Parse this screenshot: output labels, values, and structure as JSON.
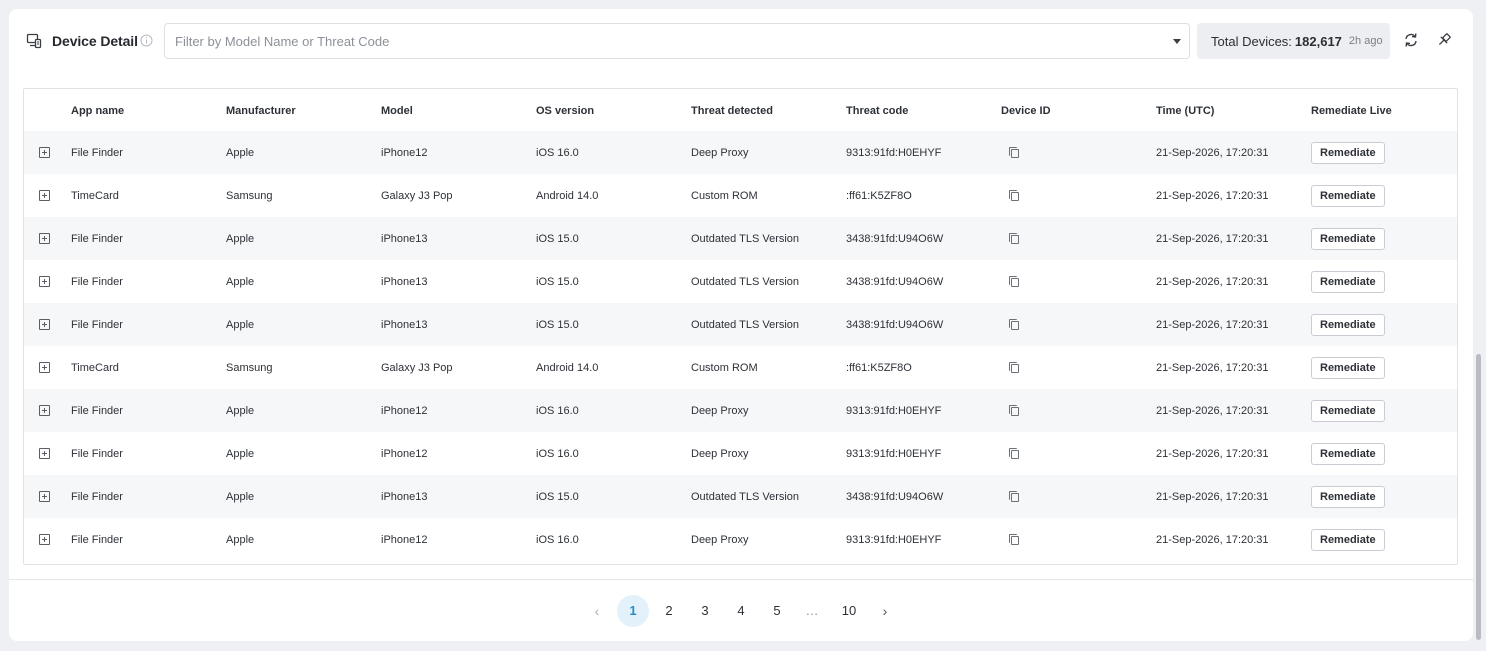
{
  "header": {
    "title": "Device Detail",
    "filter_placeholder": "Filter by Model Name or Threat Code",
    "total_label": "Total Devices:",
    "total_count": "182,617",
    "updated": "2h ago"
  },
  "table": {
    "columns": [
      "App name",
      "Manufacturer",
      "Model",
      "OS version",
      "Threat detected",
      "Threat code",
      "Device ID",
      "Time (UTC)",
      "Remediate Live"
    ],
    "remediate_label": "Remediate",
    "rows": [
      {
        "app": "File Finder",
        "manufacturer": "Apple",
        "model": "iPhone12",
        "os": "iOS 16.0",
        "threat": "Deep Proxy",
        "code": "9313:91fd:H0EHYF",
        "time": "21-Sep-2026, 17:20:31"
      },
      {
        "app": "TimeCard",
        "manufacturer": "Samsung",
        "model": "Galaxy J3 Pop",
        "os": "Android 14.0",
        "threat": "Custom ROM",
        "code": ":ff61:K5ZF8O",
        "time": "21-Sep-2026, 17:20:31"
      },
      {
        "app": "File Finder",
        "manufacturer": "Apple",
        "model": "iPhone13",
        "os": "iOS 15.0",
        "threat": "Outdated TLS Version",
        "code": "3438:91fd:U94O6W",
        "time": "21-Sep-2026, 17:20:31"
      },
      {
        "app": "File Finder",
        "manufacturer": "Apple",
        "model": "iPhone13",
        "os": "iOS 15.0",
        "threat": "Outdated TLS Version",
        "code": "3438:91fd:U94O6W",
        "time": "21-Sep-2026, 17:20:31"
      },
      {
        "app": "File Finder",
        "manufacturer": "Apple",
        "model": "iPhone13",
        "os": "iOS 15.0",
        "threat": "Outdated TLS Version",
        "code": "3438:91fd:U94O6W",
        "time": "21-Sep-2026, 17:20:31"
      },
      {
        "app": "TimeCard",
        "manufacturer": "Samsung",
        "model": "Galaxy J3 Pop",
        "os": "Android 14.0",
        "threat": "Custom ROM",
        "code": ":ff61:K5ZF8O",
        "time": "21-Sep-2026, 17:20:31"
      },
      {
        "app": "File Finder",
        "manufacturer": "Apple",
        "model": "iPhone12",
        "os": "iOS 16.0",
        "threat": "Deep Proxy",
        "code": "9313:91fd:H0EHYF",
        "time": "21-Sep-2026, 17:20:31"
      },
      {
        "app": "File Finder",
        "manufacturer": "Apple",
        "model": "iPhone12",
        "os": "iOS 16.0",
        "threat": "Deep Proxy",
        "code": "9313:91fd:H0EHYF",
        "time": "21-Sep-2026, 17:20:31"
      },
      {
        "app": "File Finder",
        "manufacturer": "Apple",
        "model": "iPhone13",
        "os": "iOS 15.0",
        "threat": "Outdated TLS Version",
        "code": "3438:91fd:U94O6W",
        "time": "21-Sep-2026, 17:20:31"
      },
      {
        "app": "File Finder",
        "manufacturer": "Apple",
        "model": "iPhone12",
        "os": "iOS 16.0",
        "threat": "Deep Proxy",
        "code": "9313:91fd:H0EHYF",
        "time": "21-Sep-2026, 17:20:31"
      }
    ]
  },
  "pagination": {
    "prev_symbol": "‹",
    "next_symbol": "›",
    "pages": [
      "1",
      "2",
      "3",
      "4",
      "5"
    ],
    "ellipsis": "…",
    "last_page": "10",
    "current_page": "1"
  },
  "colors": {
    "accent": "#2a8fc7",
    "active_page_bg": "#e3f1fa",
    "page_bg": "#eef0f3"
  },
  "icons": {
    "title": "device-list-icon",
    "info": "info-icon",
    "refresh": "refresh-icon",
    "pin": "pin-icon",
    "expand": "expand-plus-icon",
    "copy": "copy-icon"
  }
}
